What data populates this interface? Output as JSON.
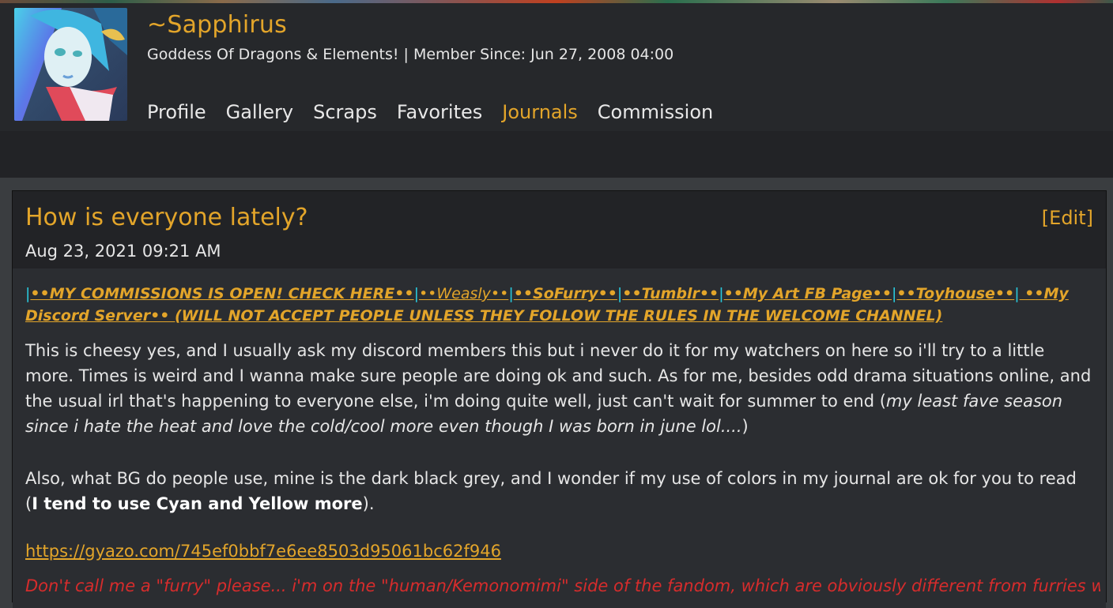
{
  "profile": {
    "username": "~Sapphirus",
    "subtitle": "Goddess Of Dragons & Elements! | Member Since: Jun 27, 2008 04:00"
  },
  "nav": {
    "items": [
      {
        "label": "Profile"
      },
      {
        "label": "Gallery"
      },
      {
        "label": "Scraps"
      },
      {
        "label": "Favorites"
      },
      {
        "label": "Journals"
      },
      {
        "label": "Commission"
      }
    ],
    "active": "Journals"
  },
  "journal": {
    "title": "How is everyone lately?",
    "edit_label": "[Edit]",
    "date": "Aug 23, 2021 09:21 AM",
    "links": {
      "sep": "|",
      "commissions": "••MY COMMISSIONS IS OPEN! CHECK HERE••",
      "weasly": "••Weasly••",
      "sofurry": "••SoFurry••",
      "tumblr": "••Tumblr••",
      "fb": "••My Art FB Page••",
      "toyhouse": "••Toyhouse••",
      "discord": " ••My Discord Server•• (WILL NOT ACCEPT PEOPLE UNLESS THEY FOLLOW THE RULES IN THE WELCOME CHANNEL)"
    },
    "para1_text": "This is cheesy yes, and I usually ask my discord members this but i never do it for my watchers on here so i'll try to a little more. Times is weird and I wanna make sure people are doing ok and such. As for me, besides odd drama situations online, and the usual irl that's happening to everyone else, i'm doing quite well, just can't wait for summer to end (",
    "para1_italic": "my least fave season since i hate the heat and love the cold/cool more even though I was born in june lol....",
    "para1_end": ")",
    "para2_text": "Also, what BG do people use, mine is the dark black grey, and I wonder if my use of colors in my journal are ok for you to read (",
    "para2_bold": "I tend to use Cyan and Yellow more",
    "para2_end": ").",
    "gyazo_link": "https://gyazo.com/745ef0bbf7e6ee8503d95061bc62f946",
    "red_note": "Don't call me a \"furry\" please... i'm on the \"human/Kemonomimi\" side of the fandom, which are obviously different from furries which are animals"
  },
  "colors": {
    "accent": "#e3a52a",
    "cyan": "#29c8dc",
    "red_note": "#d62c2c",
    "bg_dark": "#222326"
  },
  "icons": {
    "avatar": "anime-avatar-image"
  }
}
